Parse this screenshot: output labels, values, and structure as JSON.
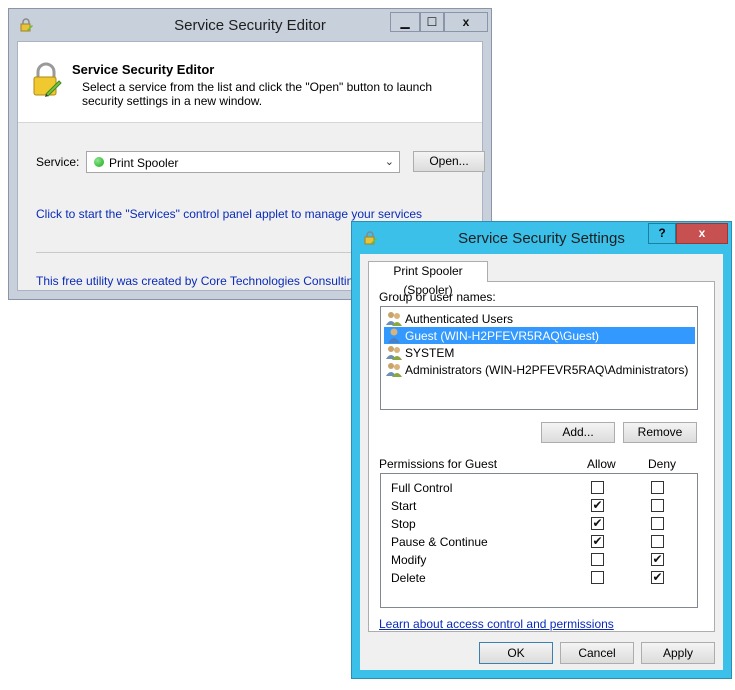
{
  "editor": {
    "title": "Service Security Editor",
    "window_buttons": {
      "minimize": "▁",
      "maximize": "☐",
      "close": "x"
    },
    "header_title": "Service Security Editor",
    "header_description": "Select a service from the list and click the \"Open\" button to launch security settings in a new window.",
    "service_label": "Service:",
    "service_selected": "Print Spooler",
    "open_button": "Open...",
    "services_link": "Click to start the \"Services\" control panel applet to manage your services",
    "credit_link": "This free utility was created by Core Technologies Consulting, LLC"
  },
  "settings": {
    "title": "Service Security Settings",
    "help_button": "?",
    "close_button": "x",
    "tab": "Print Spooler (Spooler)",
    "group_label": "Group or user names:",
    "users": [
      {
        "name": "Authenticated Users",
        "icon": "group-icon",
        "selected": false
      },
      {
        "name": "Guest (WIN-H2PFEVR5RAQ\\Guest)",
        "icon": "user-icon",
        "selected": true
      },
      {
        "name": "SYSTEM",
        "icon": "group-icon",
        "selected": false
      },
      {
        "name": "Administrators (WIN-H2PFEVR5RAQ\\Administrators)",
        "icon": "group-icon",
        "selected": false
      }
    ],
    "add_button": "Add...",
    "remove_button": "Remove",
    "permissions_label": "Permissions for Guest",
    "allow_header": "Allow",
    "deny_header": "Deny",
    "permissions": [
      {
        "name": "Full Control",
        "allow": false,
        "deny": false
      },
      {
        "name": "Start",
        "allow": true,
        "deny": false
      },
      {
        "name": "Stop",
        "allow": true,
        "deny": false
      },
      {
        "name": "Pause & Continue",
        "allow": true,
        "deny": false
      },
      {
        "name": "Modify",
        "allow": false,
        "deny": true
      },
      {
        "name": "Delete",
        "allow": false,
        "deny": true
      }
    ],
    "learn_link": "Learn about access control and permissions",
    "ok_button": "OK",
    "cancel_button": "Cancel",
    "apply_button": "Apply"
  }
}
